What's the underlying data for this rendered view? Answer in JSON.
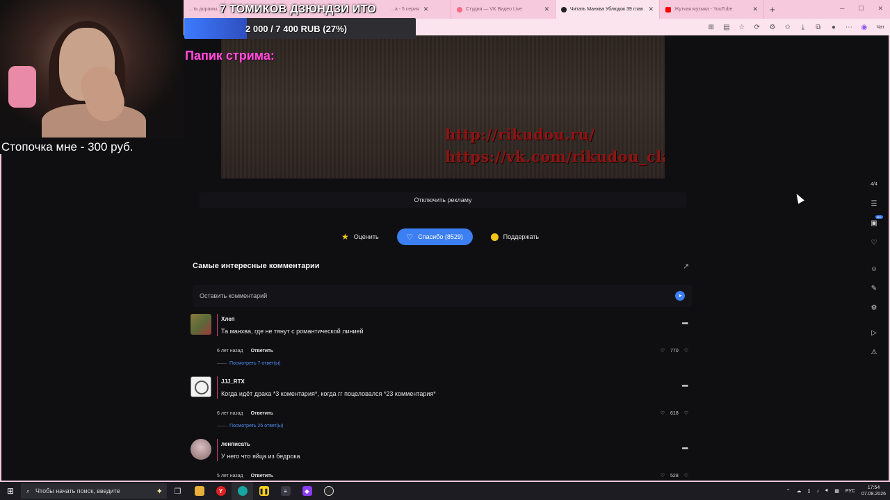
{
  "browser": {
    "tabs": [
      {
        "label": "...ть дорамы...",
        "active": false,
        "color": "#ff6a88"
      },
      {
        "label": "...а - 5 серия",
        "active": false,
        "color": "#ff6a88"
      },
      {
        "label": "Студия — VK Видео Live",
        "active": false,
        "color": "#ff6a88"
      },
      {
        "label": "Читать Манхва Ублюдок 39 глав",
        "active": true,
        "color": "#222222"
      },
      {
        "label": "Жуткая музыка - YouTube",
        "active": false,
        "color": "#ff0000"
      }
    ],
    "chat_label": "Чат"
  },
  "overlay": {
    "goal_title": "7 ТОМИКОВ ДЗЮНДЗИ ИТО",
    "goal_text": "2 000 / 7 400 RUB (27%)",
    "goal_progress": 0.27,
    "papik": "Папик стрима:",
    "stopochka": "Стопочка мне - 300 руб."
  },
  "ad": {
    "link1": "http://rikudou.ru/",
    "link2": "https://vk.com/rikudou_clan",
    "disable_label": "Отключить рекламу"
  },
  "actions": {
    "rate": "Оценить",
    "thanks": "Спасибо (8529)",
    "support": "Поддержать"
  },
  "comments": {
    "title": "Самые интересные комментарии",
    "input_placeholder": "Оставить комментарий",
    "reply_label": "Ответить",
    "items": [
      {
        "name": "Хлеп",
        "text": "Та манхва, где не тянут с романтической линией",
        "time": "6 лет назад",
        "likes": "770",
        "replies": "Посмотреть 7 ответ(ы)"
      },
      {
        "name": "JJJ_RTX",
        "text": "Когда идёт драка *3 коментария*, когда гг поцеловался *23 комментария*",
        "time": "6 лет назад",
        "likes": "618",
        "replies": "Посмотреть 26 ответ(ы)"
      },
      {
        "name": "ленписать",
        "text": "У него что яйца из бедрока",
        "time": "5 лет назад",
        "likes": "528"
      }
    ]
  },
  "rail": {
    "page": "4/4",
    "badge": "99+"
  },
  "taskbar": {
    "search_placeholder": "Чтобы начать поиск, введите",
    "lang": "РУС",
    "time": "17:54",
    "date": "07.08.2026"
  }
}
